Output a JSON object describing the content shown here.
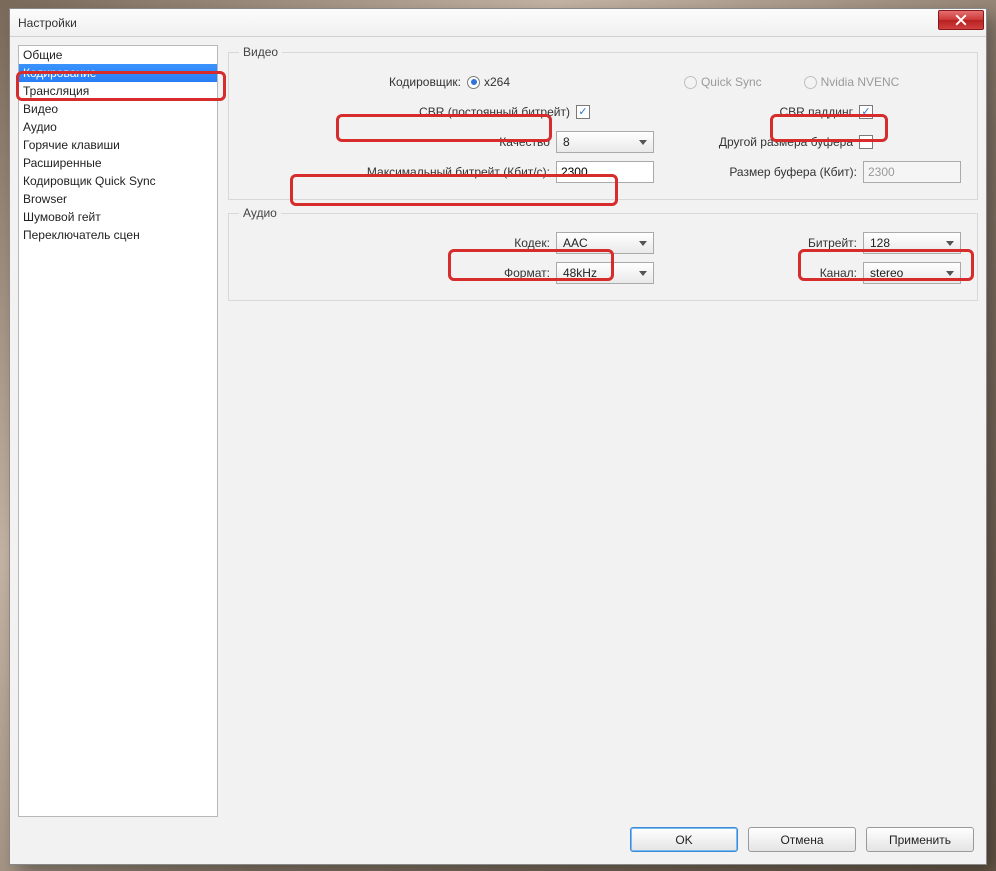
{
  "window": {
    "title": "Настройки"
  },
  "sidebar": {
    "items": [
      "Общие",
      "Кодирование",
      "Трансляция",
      "Видео",
      "Аудио",
      "Горячие клавиши",
      "Расширенные",
      "Кодировщик Quick Sync",
      "Browser",
      "Шумовой гейт",
      "Переключатель сцен"
    ],
    "selected_index": 1
  },
  "video": {
    "legend": "Видео",
    "encoder_label": "Кодировщик:",
    "encoders": {
      "x264": "x264",
      "quicksync": "Quick Sync",
      "nvenc": "Nvidia NVENC"
    },
    "cbr_label": "CBR (постоянный битрейт)",
    "cbr_padding_label": "CBR паддинг",
    "quality_label": "Качество",
    "quality_value": "8",
    "buffer_other_label": "Другой размера буфера",
    "max_bitrate_label": "Максимальный битрейт (Кбит/с):",
    "max_bitrate_value": "2300",
    "buffer_size_label": "Размер буфера (Кбит):",
    "buffer_size_value": "2300"
  },
  "audio": {
    "legend": "Аудио",
    "codec_label": "Кодек:",
    "codec_value": "AAC",
    "bitrate_label": "Битрейт:",
    "bitrate_value": "128",
    "format_label": "Формат:",
    "format_value": "48kHz",
    "channel_label": "Канал:",
    "channel_value": "stereo"
  },
  "buttons": {
    "ok": "OK",
    "cancel": "Отмена",
    "apply": "Применить"
  }
}
